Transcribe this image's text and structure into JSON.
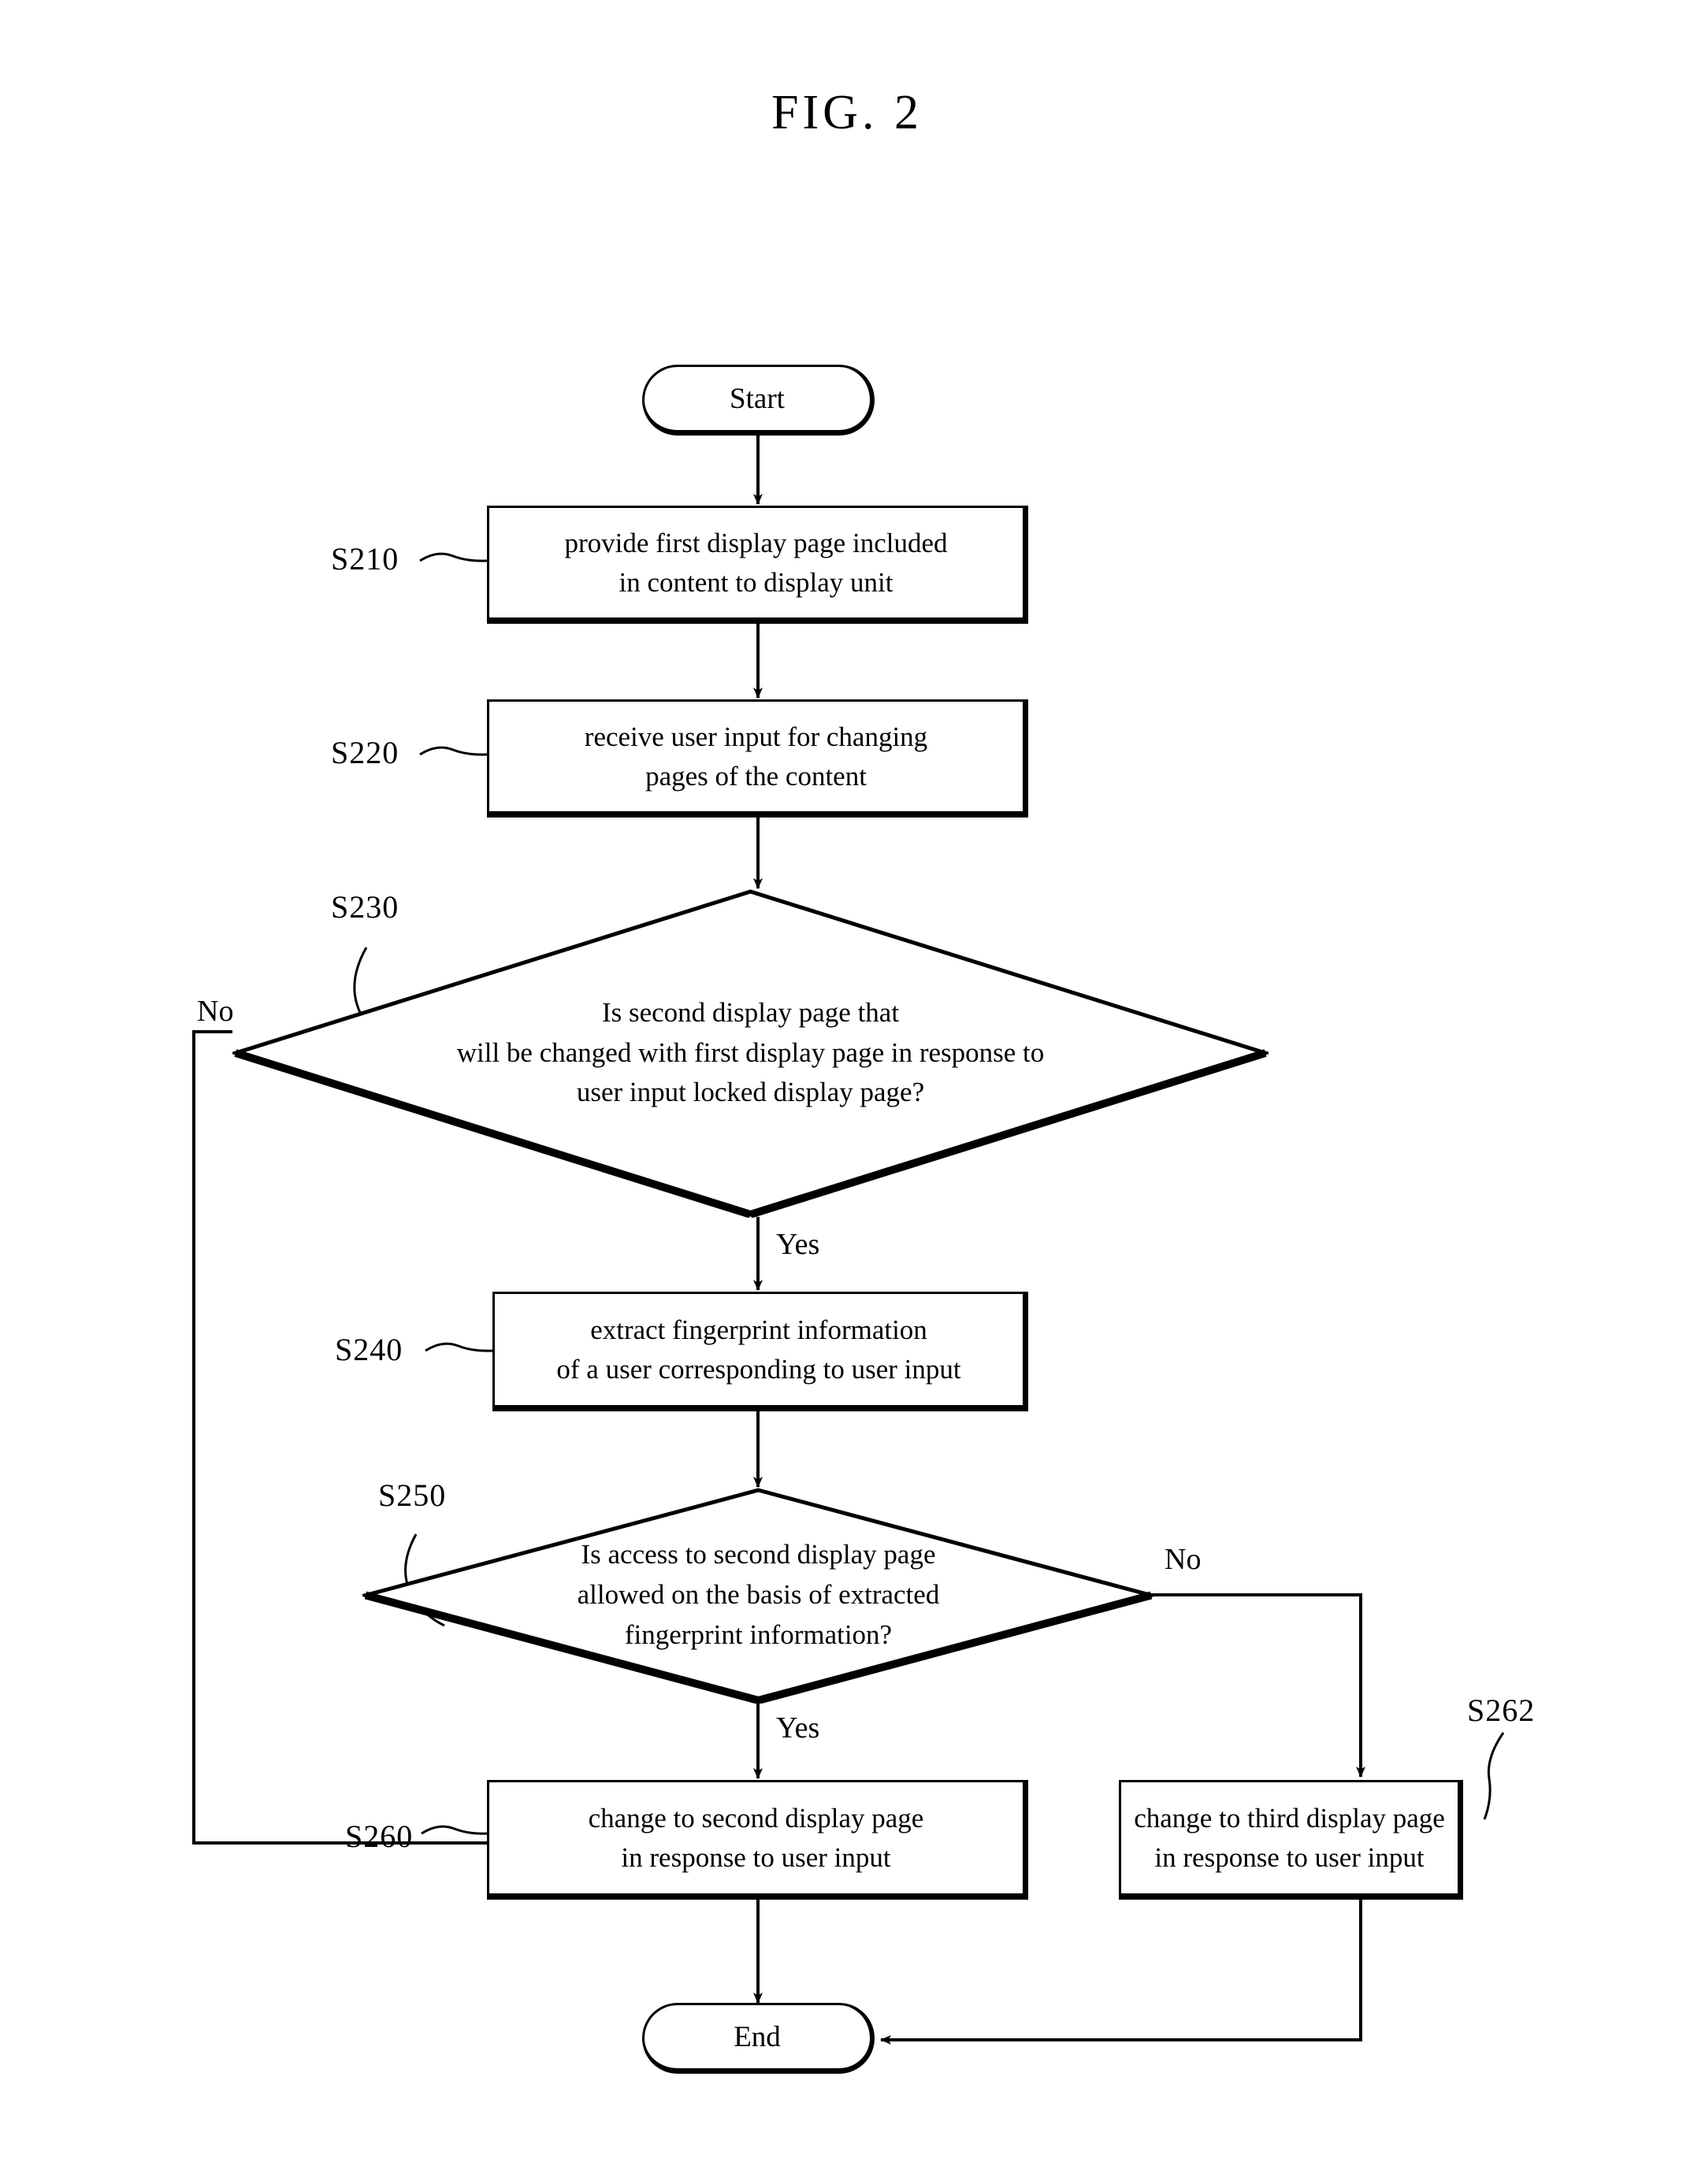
{
  "figure": {
    "title": "FIG. 2"
  },
  "nodes": {
    "start": {
      "label": "Start"
    },
    "end": {
      "label": "End"
    },
    "s210": {
      "ref": "S210",
      "line1": "provide first display page included",
      "line2": "in content to display unit"
    },
    "s220": {
      "ref": "S220",
      "line1": "receive user input for changing",
      "line2": "pages of the content"
    },
    "s230": {
      "ref": "S230",
      "line1": "Is second display page that",
      "line2": "will be changed with first display page in response to",
      "line3": "user input locked display page?"
    },
    "s240": {
      "ref": "S240",
      "line1": "extract fingerprint information",
      "line2": "of a user corresponding to user input"
    },
    "s250": {
      "ref": "S250",
      "line1": "Is access to second display page",
      "line2": "allowed on the basis of extracted",
      "line3": "fingerprint information?"
    },
    "s260": {
      "ref": "S260",
      "line1": "change to second display page",
      "line2": "in response to user input"
    },
    "s262": {
      "ref": "S262",
      "line1": "change to third display page",
      "line2": "in response to user input"
    }
  },
  "branches": {
    "s230_no": "No",
    "s230_yes": "Yes",
    "s250_no": "No",
    "s250_yes": "Yes"
  },
  "style": {
    "ink": "#000000",
    "paper": "#ffffff"
  }
}
